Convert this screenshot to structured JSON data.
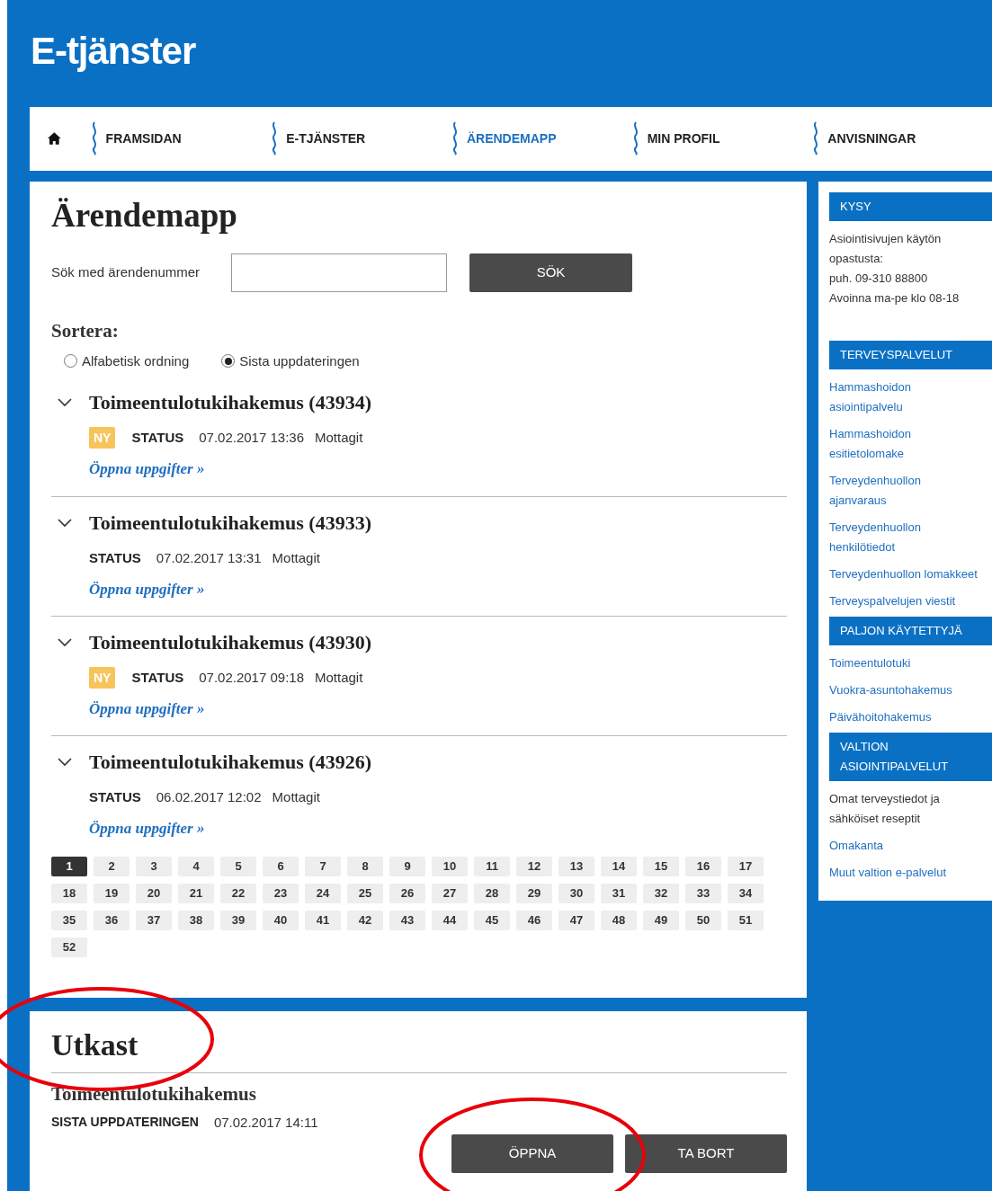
{
  "header": {
    "title": "E-tjänster"
  },
  "nav": [
    {
      "label": "FRAMSIDAN",
      "selected": false
    },
    {
      "label": "E-TJÄNSTER",
      "selected": false
    },
    {
      "label": "ÄRENDEMAPP",
      "selected": true
    },
    {
      "label": "MIN PROFIL",
      "selected": false
    },
    {
      "label": "ANVISNINGAR",
      "selected": false
    }
  ],
  "main": {
    "title": "Ärendemapp",
    "search": {
      "label": "Sök med ärendenummer",
      "button": "SÖK"
    },
    "sort": {
      "label": "Sortera:",
      "options": [
        {
          "label": "Alfabetisk ordning",
          "selected": false
        },
        {
          "label": "Sista uppdateringen",
          "selected": true
        }
      ]
    },
    "cases": [
      {
        "title": "Toimeentulotukihakemus (43934)",
        "badge": "NY",
        "status_label": "STATUS",
        "date": "07.02.2017 13:36",
        "status": "Mottagit",
        "link": "Öppna uppgifter »"
      },
      {
        "title": "Toimeentulotukihakemus (43933)",
        "status_label": "STATUS",
        "date": "07.02.2017 13:31",
        "status": "Mottagit",
        "link": "Öppna uppgifter »"
      },
      {
        "title": "Toimeentulotukihakemus (43930)",
        "badge": "NY",
        "status_label": "STATUS",
        "date": "07.02.2017 09:18",
        "status": "Mottagit",
        "link": "Öppna uppgifter »"
      },
      {
        "title": "Toimeentulotukihakemus (43926)",
        "status_label": "STATUS",
        "date": "06.02.2017 12:02",
        "status": "Mottagit",
        "link": "Öppna uppgifter »"
      }
    ],
    "pagination": [
      {
        "label": "1",
        "selected": true
      },
      {
        "label": "2",
        "selected": false
      },
      {
        "label": "3",
        "selected": false
      },
      {
        "label": "4",
        "selected": false
      },
      {
        "label": "5",
        "selected": false
      },
      {
        "label": "6",
        "selected": false
      },
      {
        "label": "7",
        "selected": false
      },
      {
        "label": "8",
        "selected": false
      },
      {
        "label": "9",
        "selected": false
      },
      {
        "label": "10",
        "selected": false
      },
      {
        "label": "11",
        "selected": false
      },
      {
        "label": "12",
        "selected": false
      },
      {
        "label": "13",
        "selected": false
      },
      {
        "label": "14",
        "selected": false
      },
      {
        "label": "15",
        "selected": false
      },
      {
        "label": "16",
        "selected": false
      },
      {
        "label": "17",
        "selected": false
      },
      {
        "label": "18",
        "selected": false
      },
      {
        "label": "19",
        "selected": false
      },
      {
        "label": "20",
        "selected": false
      },
      {
        "label": "21",
        "selected": false
      },
      {
        "label": "22",
        "selected": false
      },
      {
        "label": "23",
        "selected": false
      },
      {
        "label": "24",
        "selected": false
      },
      {
        "label": "25",
        "selected": false
      },
      {
        "label": "26",
        "selected": false
      },
      {
        "label": "27",
        "selected": false
      },
      {
        "label": "28",
        "selected": false
      },
      {
        "label": "29",
        "selected": false
      },
      {
        "label": "30",
        "selected": false
      },
      {
        "label": "31",
        "selected": false
      },
      {
        "label": "32",
        "selected": false
      },
      {
        "label": "33",
        "selected": false
      },
      {
        "label": "34",
        "selected": false
      },
      {
        "label": "35",
        "selected": false
      },
      {
        "label": "36",
        "selected": false
      },
      {
        "label": "37",
        "selected": false
      },
      {
        "label": "38",
        "selected": false
      },
      {
        "label": "39",
        "selected": false
      },
      {
        "label": "40",
        "selected": false
      },
      {
        "label": "41",
        "selected": false
      },
      {
        "label": "42",
        "selected": false
      },
      {
        "label": "43",
        "selected": false
      },
      {
        "label": "44",
        "selected": false
      },
      {
        "label": "45",
        "selected": false
      },
      {
        "label": "46",
        "selected": false
      },
      {
        "label": "47",
        "selected": false
      },
      {
        "label": "48",
        "selected": false
      },
      {
        "label": "49",
        "selected": false
      },
      {
        "label": "50",
        "selected": false
      },
      {
        "label": "51",
        "selected": false
      },
      {
        "label": "52",
        "selected": false
      }
    ]
  },
  "drafts": {
    "title": "Utkast",
    "items": [
      {
        "title": "Toimeentulotukihakemus",
        "updated_label": "SISTA UPPDATERINGEN",
        "updated": "07.02.2017 14:11",
        "buttons": [
          "ÖPPNA",
          "TA BORT"
        ]
      }
    ]
  },
  "sidebar": [
    {
      "title": "KYSY",
      "items": [
        {
          "kind": "text",
          "text": "Asiointisivujen käytön opastusta:"
        },
        {
          "kind": "text",
          "text": "puh. 09-310 88800"
        },
        {
          "kind": "text",
          "text": "Avoinna ma-pe klo 08-18"
        }
      ]
    },
    {
      "title": "TERVEYSPALVELUT",
      "items": [
        {
          "kind": "link",
          "text": "Hammashoidon asiointipalvelu"
        },
        {
          "kind": "link",
          "text": "Hammashoidon esitietolomake"
        },
        {
          "kind": "link",
          "text": "Terveydenhuollon ajanvaraus"
        },
        {
          "kind": "link",
          "text": "Terveydenhuollon henkilötiedot"
        },
        {
          "kind": "link",
          "text": "Terveydenhuollon lomakkeet"
        },
        {
          "kind": "link",
          "text": "Terveyspalvelujen viestit"
        }
      ]
    },
    {
      "title": "PALJON KÄYTETTYJÄ",
      "items": [
        {
          "kind": "link",
          "text": "Toimeentulotuki"
        },
        {
          "kind": "link",
          "text": "Vuokra-asuntohakemus"
        },
        {
          "kind": "link",
          "text": "Päivähoitohakemus"
        }
      ]
    },
    {
      "title": "VALTION ASIOINTIPALVELUT",
      "items": [
        {
          "kind": "text",
          "text": "Omat terveystiedot ja sähköiset reseptit"
        },
        {
          "kind": "link",
          "text": "Omakanta"
        },
        {
          "kind": "link",
          "text": "Muut valtion e-palvelut"
        }
      ]
    }
  ],
  "annotations": [
    {
      "kind": "ellipse"
    },
    {
      "kind": "ellipse"
    }
  ]
}
